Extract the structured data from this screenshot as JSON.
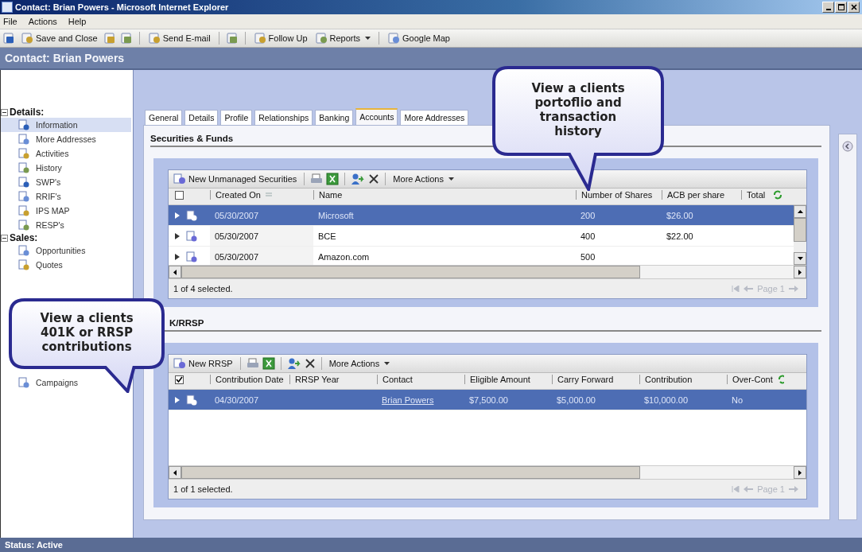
{
  "window": {
    "title": "Contact: Brian Powers - Microsoft Internet Explorer"
  },
  "menu": [
    "File",
    "Actions",
    "Help"
  ],
  "toolbar": [
    {
      "kind": "icon"
    },
    {
      "kind": "button",
      "label": "Save and Close"
    },
    {
      "kind": "icon"
    },
    {
      "kind": "icon"
    },
    {
      "kind": "separator"
    },
    {
      "kind": "button",
      "label": "Send E-mail"
    },
    {
      "kind": "separator"
    },
    {
      "kind": "icon"
    },
    {
      "kind": "separator"
    },
    {
      "kind": "button",
      "label": "Follow Up"
    },
    {
      "kind": "dropdown",
      "label": "Reports"
    },
    {
      "kind": "separator"
    },
    {
      "kind": "button",
      "label": "Google Map"
    }
  ],
  "header": {
    "title": "Contact: Brian Powers"
  },
  "sidebar": {
    "sections": [
      {
        "title": "Details:",
        "expanded": true,
        "items": [
          {
            "label": "Information",
            "selected": true
          },
          {
            "label": "More Addresses",
            "selected": false
          },
          {
            "label": "Activities",
            "selected": false
          },
          {
            "label": "History",
            "selected": false
          },
          {
            "label": "SWP's",
            "selected": false
          },
          {
            "label": "RRIF's",
            "selected": false
          },
          {
            "label": "IPS MAP",
            "selected": false
          },
          {
            "label": "RESP's",
            "selected": false
          }
        ]
      },
      {
        "title": "Sales:",
        "expanded": true,
        "items": [
          {
            "label": "Opportunities",
            "selected": false
          },
          {
            "label": "Quotes",
            "selected": false
          }
        ]
      }
    ],
    "lower_items": [
      {
        "label": "Campaigns",
        "selected": false
      }
    ]
  },
  "tabs": [
    {
      "label": "General",
      "selected": false
    },
    {
      "label": "Details",
      "selected": false
    },
    {
      "label": "Profile",
      "selected": false
    },
    {
      "label": "Relationships",
      "selected": false
    },
    {
      "label": "Banking",
      "selected": false
    },
    {
      "label": "Accounts",
      "selected": true
    },
    {
      "label": "More Addresses",
      "selected": false
    }
  ],
  "sections": [
    {
      "title": "Securities & Funds",
      "grid": {
        "new_label": "New Unmanaged Securities",
        "more_actions": "More Actions",
        "all_checked": false,
        "columns": [
          {
            "label": "Created On",
            "sorted": true
          },
          {
            "label": "Name",
            "sorted": false
          },
          {
            "label": "Number of Shares",
            "sorted": false
          },
          {
            "label": "ACB per share",
            "sorted": false
          },
          {
            "label": "Total",
            "sorted": false
          }
        ],
        "rows": [
          {
            "selected": true,
            "cells": [
              "05/30/2007",
              "Microsoft",
              "200",
              "$26.00",
              ""
            ]
          },
          {
            "selected": false,
            "cells": [
              "05/30/2007",
              "BCE",
              "400",
              "$22.00",
              ""
            ]
          },
          {
            "selected": false,
            "cells": [
              "05/30/2007",
              "Amazon.com",
              "500",
              "",
              ""
            ]
          }
        ],
        "vertical_scroll": true,
        "status": "1 of 4 selected.",
        "page": "Page 1"
      }
    },
    {
      "title": "K/RRSP",
      "grid": {
        "new_label": "New RRSP",
        "more_actions": "More Actions",
        "all_checked": true,
        "columns": [
          {
            "label": "Contribution Date",
            "sorted": false
          },
          {
            "label": "RRSP Year",
            "sorted": false
          },
          {
            "label": "Contact",
            "sorted": false,
            "kind": "link"
          },
          {
            "label": "Eligible Amount",
            "sorted": false
          },
          {
            "label": "Carry Forward",
            "sorted": false
          },
          {
            "label": "Contribution",
            "sorted": false
          },
          {
            "label": "Over-Cont",
            "sorted": false
          }
        ],
        "rows": [
          {
            "selected": true,
            "cells": [
              "04/30/2007",
              "",
              "Brian Powers",
              "$7,500.00",
              "$5,000.00",
              "$10,000.00",
              "No"
            ]
          }
        ],
        "vertical_scroll": false,
        "status": "1 of 1 selected.",
        "page": "Page 1"
      }
    }
  ],
  "callouts": [
    {
      "text": "View a clients portoflio and transaction history"
    },
    {
      "text": "View a clients 401K or RRSP contributions"
    }
  ],
  "status_bar": {
    "text": "Status: Active"
  }
}
